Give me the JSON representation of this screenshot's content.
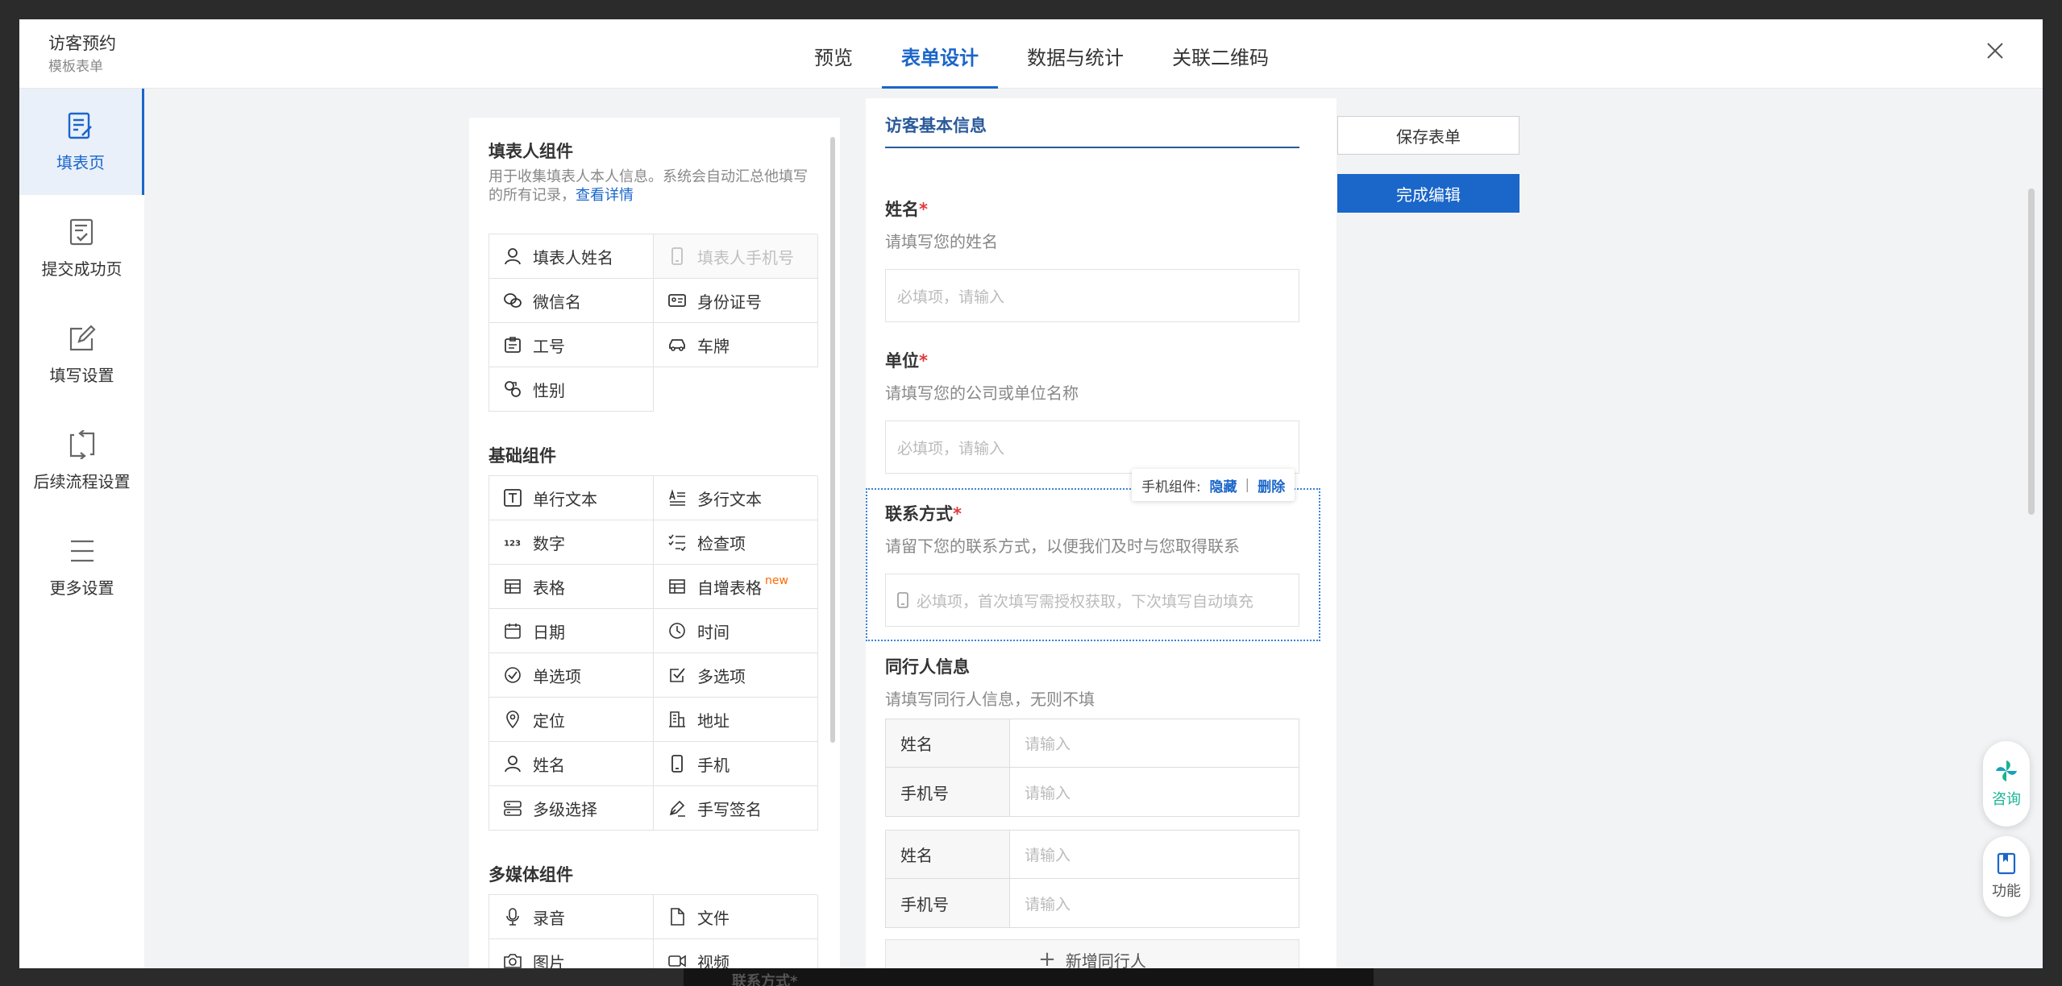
{
  "app": {
    "title": "访客预约",
    "subtitle": "模板表单"
  },
  "tabs": [
    {
      "label": "预览"
    },
    {
      "label": "表单设计",
      "active": true
    },
    {
      "label": "数据与统计"
    },
    {
      "label": "关联二维码"
    }
  ],
  "leftnav": [
    {
      "label": "填表页",
      "icon": "form-page-icon",
      "active": true
    },
    {
      "label": "提交成功页",
      "icon": "success-page-icon"
    },
    {
      "label": "填写设置",
      "icon": "edit-settings-icon"
    },
    {
      "label": "后续流程设置",
      "icon": "flow-icon"
    },
    {
      "label": "更多设置",
      "icon": "menu-icon"
    }
  ],
  "palette": {
    "filler": {
      "title": "填表人组件",
      "desc": "用于收集填表人本人信息。系统会自动汇总他填写的所有记录，",
      "link": "查看详情",
      "items": [
        {
          "label": "填表人姓名",
          "icon": "person-icon"
        },
        {
          "label": "填表人手机号",
          "icon": "phone-icon",
          "disabled": true
        },
        {
          "label": "微信名",
          "icon": "wechat-icon"
        },
        {
          "label": "身份证号",
          "icon": "id-card-icon"
        },
        {
          "label": "工号",
          "icon": "badge-icon"
        },
        {
          "label": "车牌",
          "icon": "car-icon"
        },
        {
          "label": "性别",
          "icon": "gender-icon"
        }
      ]
    },
    "basic": {
      "title": "基础组件",
      "items": [
        {
          "label": "单行文本",
          "icon": "text-icon"
        },
        {
          "label": "多行文本",
          "icon": "multiline-icon"
        },
        {
          "label": "数字",
          "icon": "number-icon"
        },
        {
          "label": "检查项",
          "icon": "checklist-icon"
        },
        {
          "label": "表格",
          "icon": "table-icon"
        },
        {
          "label": "自增表格",
          "icon": "table-icon",
          "badge": "new"
        },
        {
          "label": "日期",
          "icon": "calendar-icon"
        },
        {
          "label": "时间",
          "icon": "clock-icon"
        },
        {
          "label": "单选项",
          "icon": "radio-icon"
        },
        {
          "label": "多选项",
          "icon": "checkbox-icon"
        },
        {
          "label": "定位",
          "icon": "location-icon"
        },
        {
          "label": "地址",
          "icon": "address-icon"
        },
        {
          "label": "姓名",
          "icon": "person-icon"
        },
        {
          "label": "手机",
          "icon": "phone-icon"
        },
        {
          "label": "多级选择",
          "icon": "cascade-icon"
        },
        {
          "label": "手写签名",
          "icon": "pen-icon"
        }
      ]
    },
    "media": {
      "title": "多媒体组件",
      "items": [
        {
          "label": "录音",
          "icon": "mic-icon"
        },
        {
          "label": "文件",
          "icon": "file-icon"
        },
        {
          "label": "图片",
          "icon": "camera-icon"
        },
        {
          "label": "视频",
          "icon": "video-icon"
        }
      ]
    }
  },
  "form": {
    "section_title": "访客基本信息",
    "fields": [
      {
        "label": "姓名",
        "required": "*",
        "desc": "请填写您的姓名",
        "placeholder": "必填项，请输入"
      },
      {
        "label": "单位",
        "required": "*",
        "desc": "请填写您的公司或单位名称",
        "placeholder": "必填项，请输入"
      },
      {
        "label": "联系方式",
        "required": "*",
        "desc": "请留下您的联系方式，以便我们及时与您取得联系",
        "placeholder": "必填项，首次填写需授权获取，下次填写自动填充"
      }
    ],
    "tooltip": {
      "prefix": "手机组件:",
      "hide": "隐藏",
      "sep": "|",
      "delete": "删除"
    },
    "companions": {
      "title": "同行人信息",
      "desc": "请填写同行人信息，无则不填",
      "groups": [
        [
          {
            "label": "姓名",
            "placeholder": "请输入"
          },
          {
            "label": "手机号",
            "placeholder": "请输入"
          }
        ],
        [
          {
            "label": "姓名",
            "placeholder": "请输入"
          },
          {
            "label": "手机号",
            "placeholder": "请输入"
          }
        ]
      ],
      "add_label": "新增同行人"
    }
  },
  "actions": {
    "save": "保存表单",
    "done": "完成编辑"
  },
  "float": {
    "consult": "咨询",
    "features": "功能"
  },
  "background_text": "联系方式*",
  "colors": {
    "accent": "#1a66c9",
    "required": "#e03b3b",
    "new_badge": "#ff6a00",
    "consult": "#1ab394"
  }
}
